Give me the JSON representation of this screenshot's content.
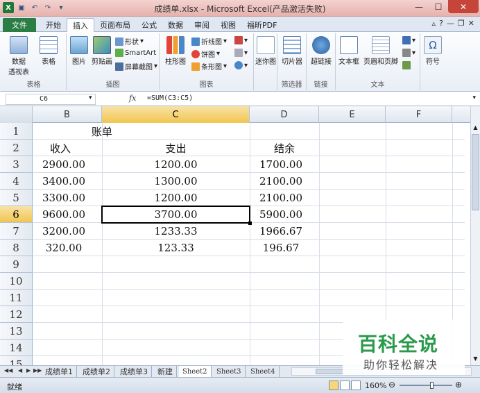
{
  "window": {
    "title": "成绩单.xlsx - Microsoft Excel(产品激活失败)",
    "qat_icons": [
      "excel-logo-icon",
      "save-icon",
      "undo-icon",
      "redo-icon",
      "customize-icon"
    ],
    "controls": {
      "minimize": "—",
      "maximize": "☐",
      "close": "✕"
    }
  },
  "ribbon_tabs": {
    "file": "文件",
    "tabs": [
      "开始",
      "插入",
      "页面布局",
      "公式",
      "数据",
      "审阅",
      "视图",
      "福昕PDF"
    ],
    "active_index": 1
  },
  "ribbon": {
    "groups": {
      "tables": {
        "label": "表格",
        "pivot": "数据\n透视表",
        "table": "表格"
      },
      "illustrations": {
        "label": "插图",
        "picture": "图片",
        "clipart": "剪贴画",
        "shapes": "形状",
        "smartart": "SmartArt",
        "screenshot": "屏幕截图"
      },
      "charts": {
        "label": "图表",
        "column": "柱形图",
        "line": "折线图",
        "pie": "饼图",
        "bar": "条形图"
      },
      "sparklines": {
        "label": "",
        "sparkline": "迷你图"
      },
      "filter": {
        "label": "筛选器",
        "slicer": "切片器"
      },
      "links": {
        "label": "链接",
        "hyperlink": "超链接"
      },
      "text": {
        "label": "文本",
        "textbox": "文本框",
        "header_footer": "页眉和页脚"
      },
      "symbols": {
        "label": "",
        "symbol": "符号"
      }
    }
  },
  "formula_bar": {
    "name_box": "C6",
    "fx": "fx",
    "formula": "=SUM(C3:C5)"
  },
  "columns": [
    "B",
    "C",
    "D",
    "E",
    "F"
  ],
  "selected_column": "C",
  "rows": [
    "1",
    "2",
    "3",
    "4",
    "5",
    "6",
    "7",
    "8",
    "9",
    "10",
    "11",
    "12",
    "13",
    "14",
    "15"
  ],
  "selected_row": "6",
  "cells": {
    "title": "账单",
    "headers": [
      "收入",
      "支出",
      "结余"
    ],
    "data": [
      [
        "2900.00",
        "1200.00",
        "1700.00"
      ],
      [
        "3400.00",
        "1300.00",
        "2100.00"
      ],
      [
        "3300.00",
        "1200.00",
        "2100.00"
      ],
      [
        "9600.00",
        "3700.00",
        "5900.00"
      ],
      [
        "3200.00",
        "1233.33",
        "1966.67"
      ],
      [
        "320.00",
        "123.33",
        "196.67"
      ]
    ]
  },
  "sheet_tabs": [
    "成绩单1",
    "成绩单2",
    "成绩单3",
    "新建",
    "Sheet2",
    "Sheet3",
    "Sheet4"
  ],
  "active_sheet": "Sheet2",
  "status": {
    "ready": "就绪",
    "zoom": "160%"
  },
  "watermark": {
    "title": "百科全说",
    "subtitle": "助你轻松解决"
  }
}
